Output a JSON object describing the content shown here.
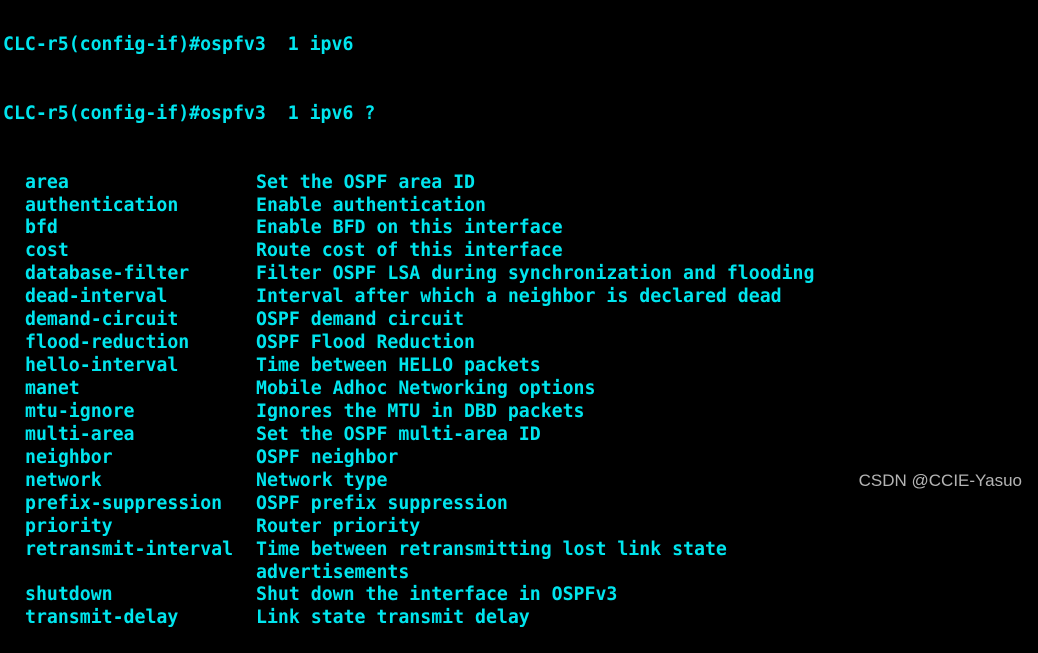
{
  "terminal": {
    "clipped_line": "CLC-r5(config-if)#ospfv3  1 ipv6",
    "prompt": "CLC-r5(config-if)#ospfv3  1 ipv6 ?",
    "options": [
      {
        "cmd": "area",
        "desc": "Set the OSPF area ID"
      },
      {
        "cmd": "authentication",
        "desc": "Enable authentication"
      },
      {
        "cmd": "bfd",
        "desc": "Enable BFD on this interface"
      },
      {
        "cmd": "cost",
        "desc": "Route cost of this interface"
      },
      {
        "cmd": "database-filter",
        "desc": "Filter OSPF LSA during synchronization and flooding"
      },
      {
        "cmd": "dead-interval",
        "desc": "Interval after which a neighbor is declared dead"
      },
      {
        "cmd": "demand-circuit",
        "desc": "OSPF demand circuit"
      },
      {
        "cmd": "flood-reduction",
        "desc": "OSPF Flood Reduction"
      },
      {
        "cmd": "hello-interval",
        "desc": "Time between HELLO packets"
      },
      {
        "cmd": "manet",
        "desc": "Mobile Adhoc Networking options"
      },
      {
        "cmd": "mtu-ignore",
        "desc": "Ignores the MTU in DBD packets"
      },
      {
        "cmd": "multi-area",
        "desc": "Set the OSPF multi-area ID"
      },
      {
        "cmd": "neighbor",
        "desc": "OSPF neighbor"
      },
      {
        "cmd": "network",
        "desc": "Network type"
      },
      {
        "cmd": "prefix-suppression",
        "desc": "OSPF prefix suppression"
      },
      {
        "cmd": "priority",
        "desc": "Router priority"
      },
      {
        "cmd": "retransmit-interval",
        "desc": "Time between retransmitting lost link state"
      },
      {
        "cmd": "",
        "desc": "advertisements"
      },
      {
        "cmd": "shutdown",
        "desc": "Shut down the interface in OSPFv3"
      },
      {
        "cmd": "transmit-delay",
        "desc": "Link state transmit delay"
      }
    ],
    "text_color": "#00e5ee",
    "background": "#000000"
  },
  "watermark": "CSDN @CCIE-Yasuo"
}
